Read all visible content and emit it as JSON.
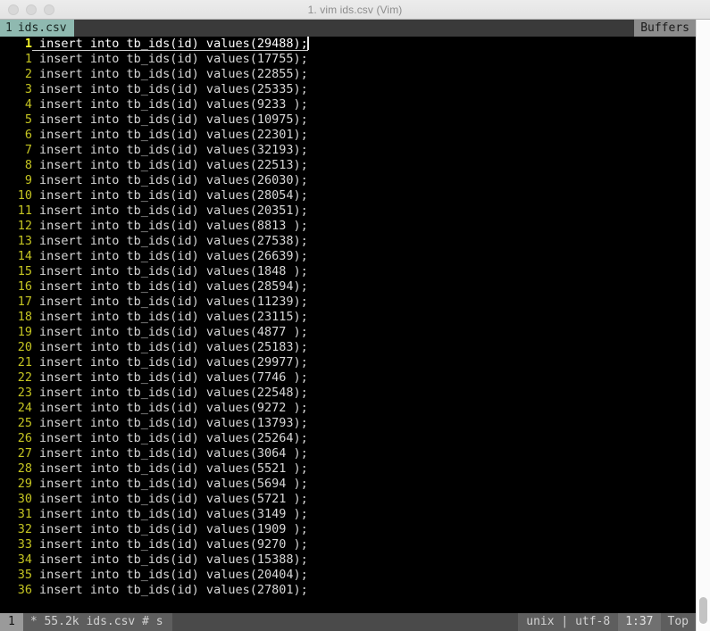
{
  "window": {
    "title": "1. vim ids.csv (Vim)",
    "traffic_lights": [
      "close",
      "minimize",
      "zoom"
    ]
  },
  "tabline": {
    "tabs": [
      {
        "number": "1",
        "label": "ids.csv",
        "active": true
      }
    ],
    "buffers_label": "Buffers"
  },
  "editor": {
    "cursor_line": {
      "number": "1",
      "text": "insert into tb_ids(id) values(29488);"
    },
    "lines": [
      {
        "number": "1",
        "text": "insert into tb_ids(id) values(17755);"
      },
      {
        "number": "2",
        "text": "insert into tb_ids(id) values(22855);"
      },
      {
        "number": "3",
        "text": "insert into tb_ids(id) values(25335);"
      },
      {
        "number": "4",
        "text": "insert into tb_ids(id) values(9233 );"
      },
      {
        "number": "5",
        "text": "insert into tb_ids(id) values(10975);"
      },
      {
        "number": "6",
        "text": "insert into tb_ids(id) values(22301);"
      },
      {
        "number": "7",
        "text": "insert into tb_ids(id) values(32193);"
      },
      {
        "number": "8",
        "text": "insert into tb_ids(id) values(22513);"
      },
      {
        "number": "9",
        "text": "insert into tb_ids(id) values(26030);"
      },
      {
        "number": "10",
        "text": "insert into tb_ids(id) values(28054);"
      },
      {
        "number": "11",
        "text": "insert into tb_ids(id) values(20351);"
      },
      {
        "number": "12",
        "text": "insert into tb_ids(id) values(8813 );"
      },
      {
        "number": "13",
        "text": "insert into tb_ids(id) values(27538);"
      },
      {
        "number": "14",
        "text": "insert into tb_ids(id) values(26639);"
      },
      {
        "number": "15",
        "text": "insert into tb_ids(id) values(1848 );"
      },
      {
        "number": "16",
        "text": "insert into tb_ids(id) values(28594);"
      },
      {
        "number": "17",
        "text": "insert into tb_ids(id) values(11239);"
      },
      {
        "number": "18",
        "text": "insert into tb_ids(id) values(23115);"
      },
      {
        "number": "19",
        "text": "insert into tb_ids(id) values(4877 );"
      },
      {
        "number": "20",
        "text": "insert into tb_ids(id) values(25183);"
      },
      {
        "number": "21",
        "text": "insert into tb_ids(id) values(29977);"
      },
      {
        "number": "22",
        "text": "insert into tb_ids(id) values(7746 );"
      },
      {
        "number": "23",
        "text": "insert into tb_ids(id) values(22548);"
      },
      {
        "number": "24",
        "text": "insert into tb_ids(id) values(9272 );"
      },
      {
        "number": "25",
        "text": "insert into tb_ids(id) values(13793);"
      },
      {
        "number": "26",
        "text": "insert into tb_ids(id) values(25264);"
      },
      {
        "number": "27",
        "text": "insert into tb_ids(id) values(3064 );"
      },
      {
        "number": "28",
        "text": "insert into tb_ids(id) values(5521 );"
      },
      {
        "number": "29",
        "text": "insert into tb_ids(id) values(5694 );"
      },
      {
        "number": "30",
        "text": "insert into tb_ids(id) values(5721 );"
      },
      {
        "number": "31",
        "text": "insert into tb_ids(id) values(3149 );"
      },
      {
        "number": "32",
        "text": "insert into tb_ids(id) values(1909 );"
      },
      {
        "number": "33",
        "text": "insert into tb_ids(id) values(9270 );"
      },
      {
        "number": "34",
        "text": "insert into tb_ids(id) values(15388);"
      },
      {
        "number": "35",
        "text": "insert into tb_ids(id) values(20404);"
      },
      {
        "number": "36",
        "text": "insert into tb_ids(id) values(27801);"
      }
    ]
  },
  "statusline": {
    "mode": "1",
    "file_info": "* 55.2k ids.csv  # s",
    "fileformat_encoding": "unix | utf-8",
    "position": "1:37",
    "scroll_percent": "Top"
  },
  "colors": {
    "background": "#000000",
    "foreground": "#d8d8d8",
    "line_number": "#c5c522",
    "tab_active_bg": "#8fb9b0",
    "tabline_bg": "#3a3a3a",
    "statusline_bg": "#4a4a4a",
    "status_mode_bg": "#9a9a9a",
    "titlebar_bg": "#ececec"
  }
}
